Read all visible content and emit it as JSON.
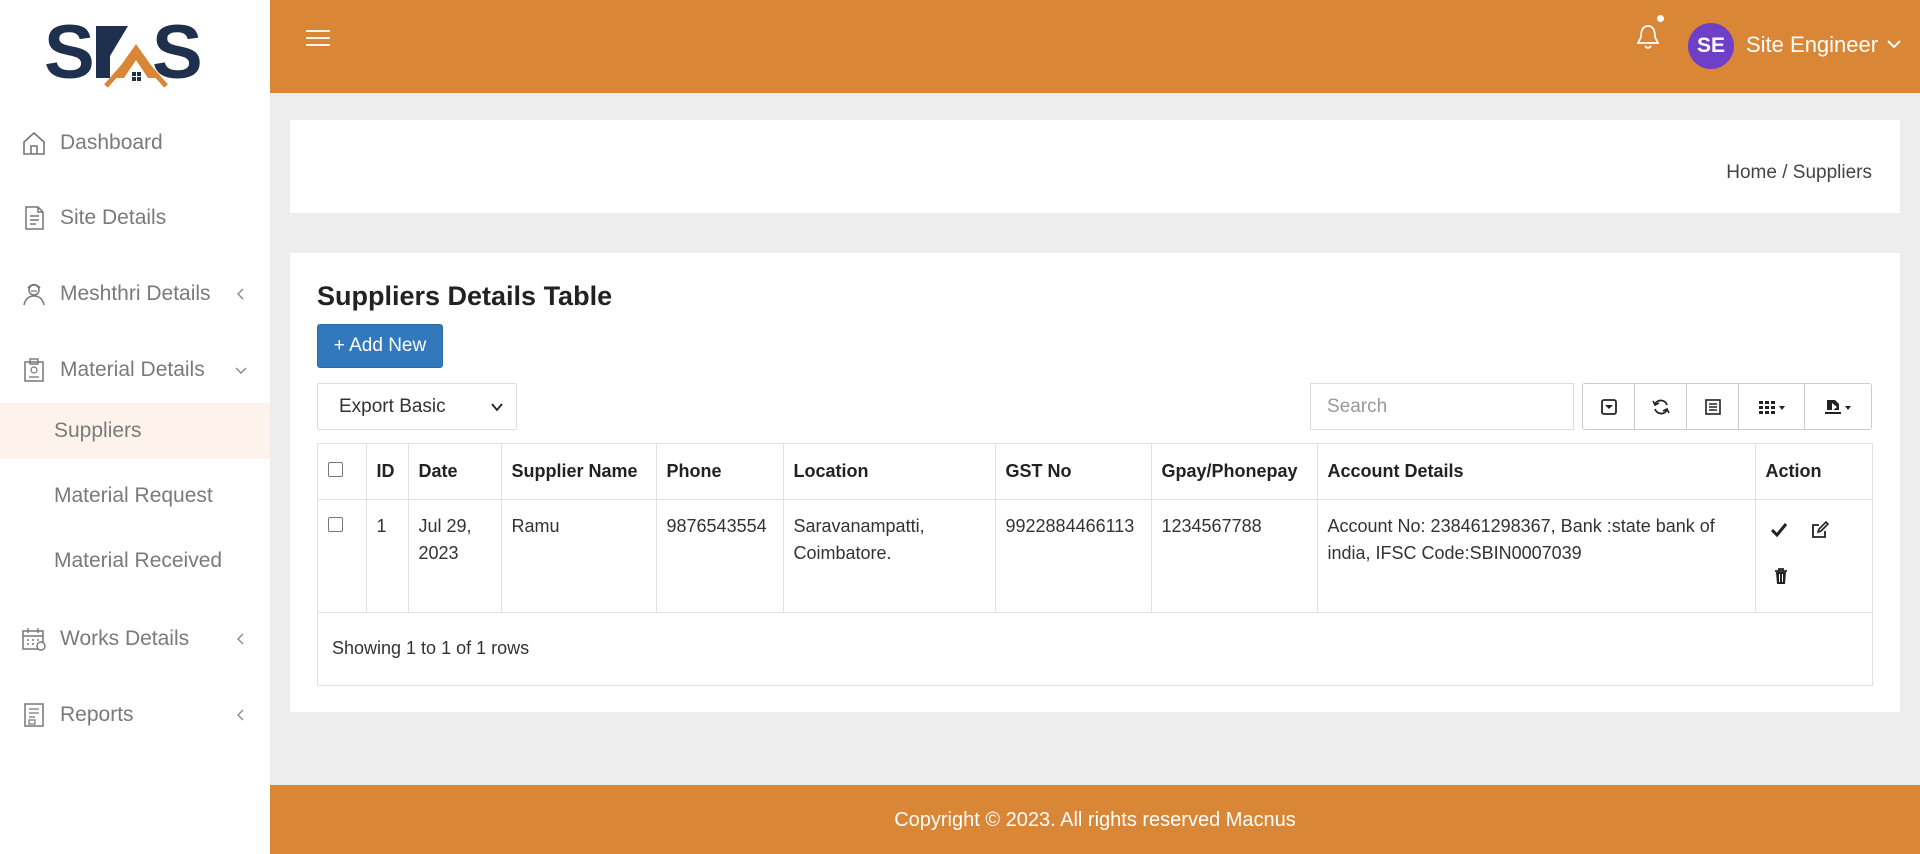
{
  "brand": {
    "logo_text": "SKS",
    "colors": {
      "primary": "#d98637",
      "navy": "#1f2f4e",
      "button": "#3179bc",
      "avatar": "#6f3fc8"
    }
  },
  "sidebar": {
    "items": [
      {
        "label": "Dashboard",
        "icon": "home-icon"
      },
      {
        "label": "Site Details",
        "icon": "document-icon"
      },
      {
        "label": "Meshthri Details",
        "icon": "worker-icon",
        "chevron": "left"
      },
      {
        "label": "Material Details",
        "icon": "clipboard-icon",
        "chevron": "down"
      },
      {
        "label": "Works Details",
        "icon": "calendar-icon",
        "chevron": "left"
      },
      {
        "label": "Reports",
        "icon": "report-icon",
        "chevron": "left"
      }
    ],
    "material_sub": [
      {
        "label": "Suppliers",
        "active": true
      },
      {
        "label": "Material Request"
      },
      {
        "label": "Material Received"
      }
    ]
  },
  "header": {
    "user_initials": "SE",
    "user_name": "Site Engineer"
  },
  "breadcrumb": {
    "home": "Home",
    "separator": "/",
    "current": "Suppliers"
  },
  "main": {
    "title": "Suppliers Details Table",
    "add_button": "+ Add New",
    "export_select": "Export Basic",
    "search_placeholder": "Search",
    "table": {
      "columns": [
        "ID",
        "Date",
        "Supplier Name",
        "Phone",
        "Location",
        "GST No",
        "Gpay/Phonepay",
        "Account Details",
        "Action"
      ],
      "rows": [
        {
          "id": "1",
          "date": "Jul 29, 2023",
          "supplier": "Ramu",
          "phone": "9876543554",
          "location": "Saravanampatti, Coimbatore.",
          "gst": "9922884466113",
          "gpay": "1234567788",
          "account": "Account No: 238461298367, Bank :state bank of india, IFSC Code:SBIN0007039"
        }
      ],
      "summary": "Showing 1 to 1 of 1 rows"
    }
  },
  "footer": {
    "text": "Copyright © 2023. All rights reserved Macnus"
  }
}
